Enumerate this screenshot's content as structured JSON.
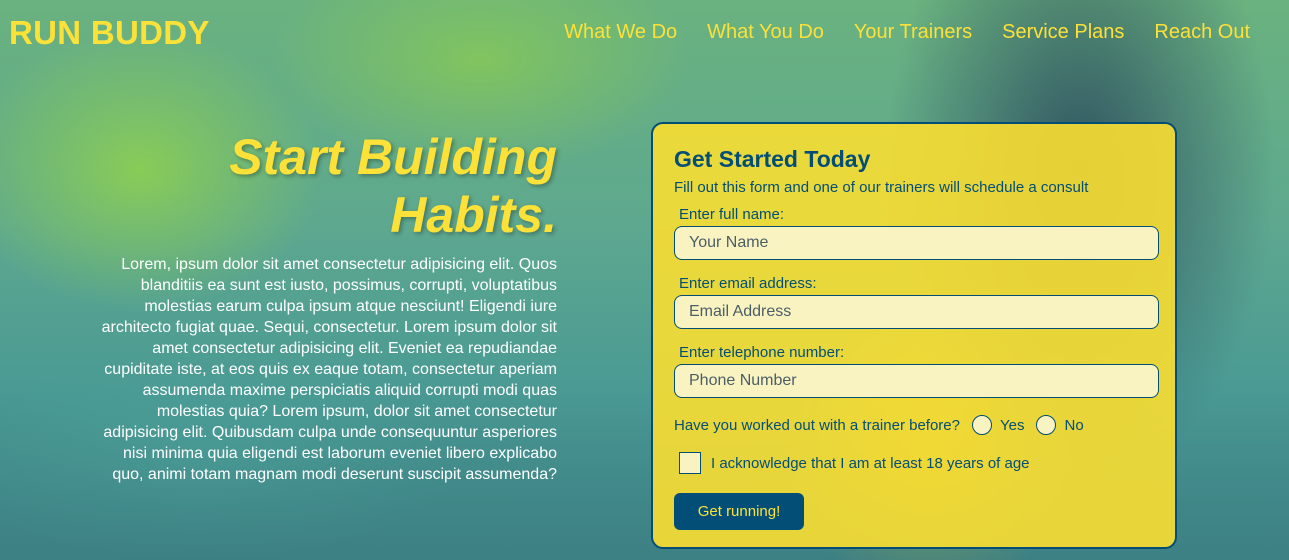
{
  "header": {
    "logo": "RUN BUDDY",
    "nav": [
      "What We Do",
      "What You Do",
      "Your Trainers",
      "Service Plans",
      "Reach Out"
    ]
  },
  "hero": {
    "title": "Start Building Habits.",
    "text": "Lorem, ipsum dolor sit amet consectetur adipisicing elit. Quos blanditiis ea sunt est iusto, possimus, corrupti, voluptatibus molestias earum culpa ipsum atque nesciunt! Eligendi iure architecto fugiat quae. Sequi, consectetur. Lorem ipsum dolor sit amet consectetur adipisicing elit. Eveniet ea repudiandae cupiditate iste, at eos quis ex eaque totam, consectetur aperiam assumenda maxime perspiciatis aliquid corrupti modi quas molestias quia? Lorem ipsum, dolor sit amet consectetur adipisicing elit. Quibusdam culpa unde consequuntur asperiores nisi minima quia eligendi est laborum eveniet libero explicabo quo, animi totam magnam modi deserunt suscipit assumenda?"
  },
  "form": {
    "title": "Get Started Today",
    "subtitle": "Fill out this form and one of our trainers will schedule a consult",
    "name_label": "Enter full name:",
    "name_placeholder": "Your Name",
    "email_label": "Enter email address:",
    "email_placeholder": "Email Address",
    "phone_label": "Enter telephone number:",
    "phone_placeholder": "Phone Number",
    "trainer_question": "Have you worked out with a trainer before?",
    "yes_label": "Yes",
    "no_label": "No",
    "acknowledge_label": "I acknowledge that I am at least 18 years of age",
    "submit_label": "Get running!"
  },
  "colors": {
    "accent": "#fce138",
    "primary": "#024e76",
    "input_bg": "#f9f3c2"
  }
}
